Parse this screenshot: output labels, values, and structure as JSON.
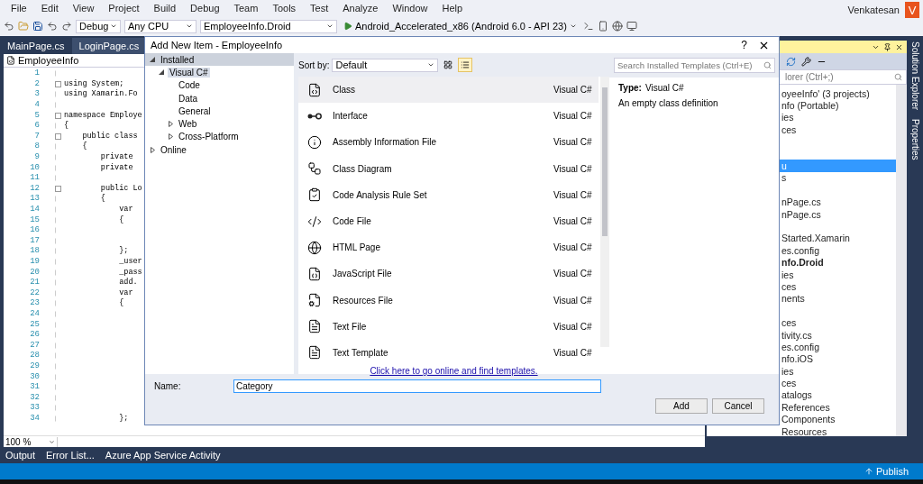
{
  "menu": [
    "File",
    "Edit",
    "View",
    "Project",
    "Build",
    "Debug",
    "Team",
    "Tools",
    "Test",
    "Analyze",
    "Window",
    "Help"
  ],
  "toolbar": {
    "configuration": "Debug",
    "platform": "Any CPU",
    "startup_project": "EmployeeInfo.Droid",
    "run_target": "Android_Accelerated_x86 (Android 6.0 - API 23)"
  },
  "account": {
    "user": "Venkatesan",
    "avatar_letter": "V"
  },
  "editor_tabs": [
    {
      "label": "MainPage.cs",
      "selected": false
    },
    {
      "label": "LoginPage.cs",
      "selected": true
    }
  ],
  "editor": {
    "navigation": "EmployeeInfo",
    "zoom": "100 %",
    "lines": [
      {
        "number": "1"
      },
      {
        "number": "2",
        "text": "using System;",
        "fold": true
      },
      {
        "number": "3",
        "text": "using Xamarin.Fo"
      },
      {
        "number": "4"
      },
      {
        "number": "5",
        "text": "namespace Employe",
        "fold": true
      },
      {
        "number": "6",
        "text": "{"
      },
      {
        "number": "7",
        "text": "    public class",
        "fold": true
      },
      {
        "number": "8",
        "text": "    {"
      },
      {
        "number": "9",
        "text": "        private"
      },
      {
        "number": "10",
        "text": "        private"
      },
      {
        "number": "11"
      },
      {
        "number": "12",
        "text": "        public Lo",
        "fold": true
      },
      {
        "number": "13",
        "text": "        {"
      },
      {
        "number": "14",
        "text": "            var"
      },
      {
        "number": "15",
        "text": "            {"
      },
      {
        "number": "16"
      },
      {
        "number": "17"
      },
      {
        "number": "18",
        "text": "            };"
      },
      {
        "number": "19",
        "text": "            _user"
      },
      {
        "number": "20",
        "text": "            _pass"
      },
      {
        "number": "21",
        "text": "            add."
      },
      {
        "number": "22",
        "text": "            var"
      },
      {
        "number": "23",
        "text": "            {"
      },
      {
        "number": "24"
      },
      {
        "number": "25"
      },
      {
        "number": "26"
      },
      {
        "number": "27"
      },
      {
        "number": "28"
      },
      {
        "number": "29"
      },
      {
        "number": "30"
      },
      {
        "number": "31"
      },
      {
        "number": "32"
      },
      {
        "number": "33"
      },
      {
        "number": "34",
        "text": "            };"
      }
    ]
  },
  "solution_explorer": {
    "search_placeholder": "lorer (Ctrl+;)",
    "items": [
      {
        "label": "oyeeInfo' (3 projects)",
        "bold": false,
        "selected": false
      },
      {
        "label": "nfo (Portable)",
        "bold": false,
        "selected": false
      },
      {
        "label": "ies",
        "bold": false,
        "selected": false
      },
      {
        "label": "ces",
        "bold": false,
        "selected": false
      },
      {
        "selected": false
      },
      {
        "selected": false
      },
      {
        "label": "u",
        "bold": false,
        "selected": true
      },
      {
        "label": "s",
        "bold": false,
        "selected": false
      },
      {
        "selected": false
      },
      {
        "label": "nPage.cs",
        "bold": false,
        "selected": false
      },
      {
        "label": "nPage.cs",
        "bold": false,
        "selected": false
      },
      {
        "selected": false
      },
      {
        "label": "Started.Xamarin",
        "bold": false,
        "selected": false
      },
      {
        "label": "es.config",
        "bold": false,
        "selected": false
      },
      {
        "label": "nfo.Droid",
        "bold": true,
        "selected": false
      },
      {
        "label": "ies",
        "bold": false,
        "selected": false
      },
      {
        "label": "ces",
        "bold": false,
        "selected": false
      },
      {
        "label": "nents",
        "bold": false,
        "selected": false
      },
      {
        "selected": false
      },
      {
        "label": "ces",
        "bold": false,
        "selected": false
      },
      {
        "label": "tivity.cs",
        "bold": false,
        "selected": false
      },
      {
        "label": "es.config",
        "bold": false,
        "selected": false
      },
      {
        "label": "nfo.iOS",
        "bold": false,
        "selected": false
      },
      {
        "label": "ies",
        "bold": false,
        "selected": false
      },
      {
        "label": "ces",
        "bold": false,
        "selected": false
      },
      {
        "label": "atalogs",
        "bold": false,
        "selected": false
      },
      {
        "label": "References",
        "bold": false,
        "selected": false
      },
      {
        "label": "Components",
        "bold": false,
        "selected": false
      },
      {
        "label": "Resources",
        "bold": false,
        "selected": false
      }
    ]
  },
  "side_tabs": [
    "Solution Explorer",
    "Properties"
  ],
  "dialog": {
    "title": "Add New Item - EmployeeInfo",
    "help": "?",
    "tree": [
      {
        "label": "Installed",
        "expanded": true,
        "selected": true,
        "children": [
          {
            "label": "Visual C#",
            "expanded": true,
            "selected": true,
            "children": [
              {
                "label": "Code",
                "selected": false
              },
              {
                "label": "Data",
                "selected": false
              },
              {
                "label": "General",
                "selected": false
              },
              {
                "label": "Web",
                "expanded": false,
                "selected": false
              },
              {
                "label": "Cross-Platform",
                "expanded": false,
                "selected": false
              }
            ]
          }
        ]
      },
      {
        "label": "Online",
        "expanded": false,
        "selected": false
      }
    ],
    "sort_label": "Sort by:",
    "sort_value": "Default",
    "view_modes": [
      {
        "kind": "grid",
        "selected": false
      },
      {
        "kind": "list",
        "selected": true
      }
    ],
    "templates": [
      {
        "name": "Class",
        "type": "Visual C#",
        "selected": true
      },
      {
        "name": "Interface",
        "type": "Visual C#",
        "selected": false
      },
      {
        "name": "Assembly Information File",
        "type": "Visual C#",
        "selected": false
      },
      {
        "name": "Class Diagram",
        "type": "Visual C#",
        "selected": false
      },
      {
        "name": "Code Analysis Rule Set",
        "type": "Visual C#",
        "selected": false
      },
      {
        "name": "Code File",
        "type": "Visual C#",
        "selected": false
      },
      {
        "name": "HTML Page",
        "type": "Visual C#",
        "selected": false
      },
      {
        "name": "JavaScript File",
        "type": "Visual C#",
        "selected": false
      },
      {
        "name": "Resources File",
        "type": "Visual C#",
        "selected": false
      },
      {
        "name": "Text File",
        "type": "Visual C#",
        "selected": false
      },
      {
        "name": "Text Template",
        "type": "Visual C#",
        "selected": false
      }
    ],
    "online_link": "Click here to go online and find templates.",
    "search_placeholder": "Search Installed Templates (Ctrl+E)",
    "details": {
      "type_label": "Type:",
      "type_value": "Visual C#",
      "description": "An empty class definition"
    },
    "name_label": "Name:",
    "name_value": "Category",
    "buttons": [
      "Add",
      "Cancel"
    ]
  },
  "tool_tabs": [
    "Output",
    "Error List...",
    "Azure App Service Activity"
  ],
  "status_bar": {
    "publish": "Publish"
  }
}
